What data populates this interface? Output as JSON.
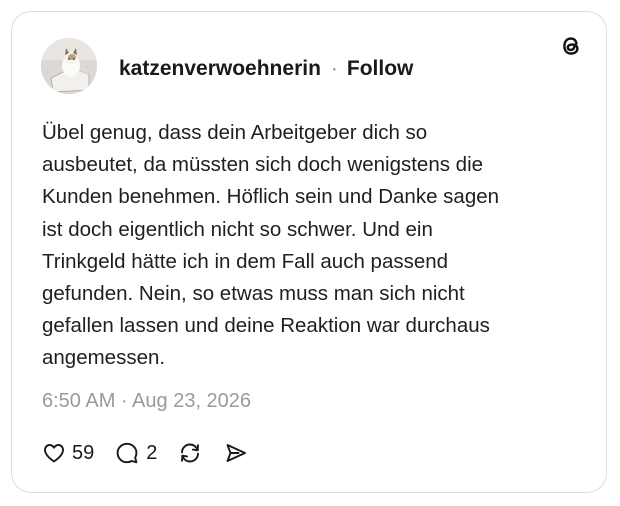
{
  "post": {
    "username": "katzenverwoehnerin",
    "separator": "·",
    "follow_label": "Follow",
    "text_lines": [
      "Übel genug, dass dein Arbeitgeber dich so",
      "ausbeutet, da müssten sich doch wenigstens die",
      "Kunden benehmen. Höflich sein und Danke sagen",
      "ist doch eigentlich nicht so schwer. Und ein",
      "Trinkgeld hätte ich in dem Fall auch passend",
      "gefunden. Nein, so etwas muss man sich nicht",
      "gefallen lassen und deine Reaktion war durchaus",
      "angemessen."
    ],
    "timestamp": "6:50 AM · Aug 23, 2026"
  },
  "actions": {
    "like_count": "59",
    "reply_count": "2"
  },
  "icons": {
    "platform": "threads-logo-icon",
    "like": "heart-icon",
    "reply": "speech-bubble-icon",
    "repost": "repost-icon",
    "share": "send-icon"
  }
}
